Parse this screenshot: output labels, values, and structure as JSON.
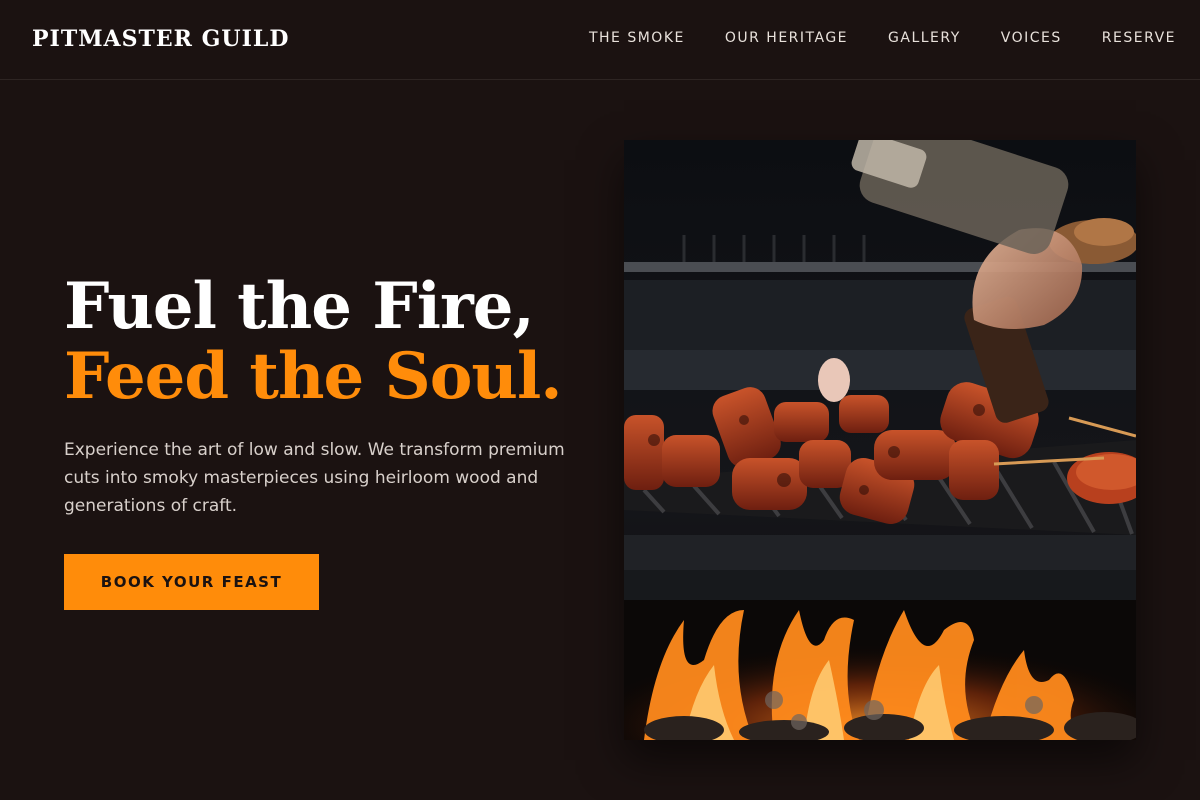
{
  "header": {
    "logo": "PITMASTER GUILD",
    "nav": [
      "THE SMOKE",
      "OUR HERITAGE",
      "GALLERY",
      "VOICES",
      "RESERVE"
    ]
  },
  "hero": {
    "headline_line1": "Fuel the Fire,",
    "headline_line2": "Feed the Soul.",
    "tagline": "Experience the art of low and slow. We transform premium cuts into smoky masterpieces using heirloom wood and generations of craft.",
    "cta_label": "BOOK YOUR FEAST"
  },
  "colors": {
    "background": "#1b1211",
    "accent": "#ff8c0a",
    "text": "#ffffff"
  }
}
